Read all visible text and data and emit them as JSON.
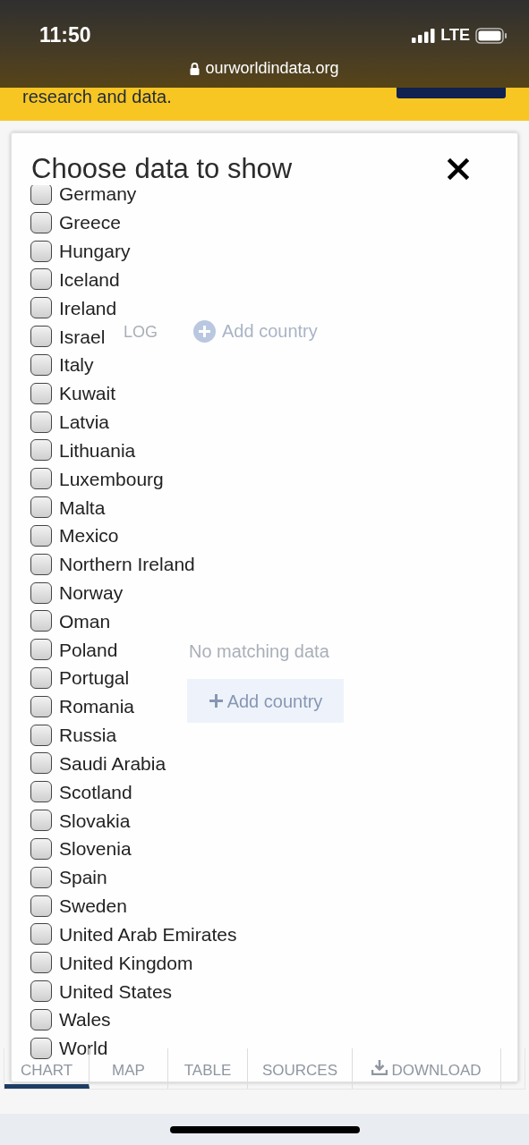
{
  "status_bar": {
    "time": "11:50",
    "network": "LTE"
  },
  "address_bar": {
    "url": "ourworldindata.org"
  },
  "banner": {
    "text": "research and data."
  },
  "background": {
    "toggle_label": "LOG",
    "add_country_link": "Add country",
    "empty_message": "No matching data",
    "add_country_button": "Add country",
    "tabs": [
      {
        "label": "CHART",
        "selected": true
      },
      {
        "label": "MAP",
        "selected": false
      },
      {
        "label": "TABLE",
        "selected": false
      },
      {
        "label": "SOURCES",
        "selected": false
      },
      {
        "label": "DOWNLOAD",
        "selected": false
      }
    ]
  },
  "dialog": {
    "title": "Choose data to show",
    "items": [
      {
        "label": "Germany",
        "checked": false
      },
      {
        "label": "Greece",
        "checked": false
      },
      {
        "label": "Hungary",
        "checked": false
      },
      {
        "label": "Iceland",
        "checked": false
      },
      {
        "label": "Ireland",
        "checked": false
      },
      {
        "label": "Israel",
        "checked": false
      },
      {
        "label": "Italy",
        "checked": false
      },
      {
        "label": "Kuwait",
        "checked": false
      },
      {
        "label": "Latvia",
        "checked": false
      },
      {
        "label": "Lithuania",
        "checked": false
      },
      {
        "label": "Luxembourg",
        "checked": false
      },
      {
        "label": "Malta",
        "checked": false
      },
      {
        "label": "Mexico",
        "checked": false
      },
      {
        "label": "Northern Ireland",
        "checked": false
      },
      {
        "label": "Norway",
        "checked": false
      },
      {
        "label": "Oman",
        "checked": false
      },
      {
        "label": "Poland",
        "checked": false
      },
      {
        "label": "Portugal",
        "checked": false
      },
      {
        "label": "Romania",
        "checked": false
      },
      {
        "label": "Russia",
        "checked": false
      },
      {
        "label": "Saudi Arabia",
        "checked": false
      },
      {
        "label": "Scotland",
        "checked": false
      },
      {
        "label": "Slovakia",
        "checked": false
      },
      {
        "label": "Slovenia",
        "checked": false
      },
      {
        "label": "Spain",
        "checked": false
      },
      {
        "label": "Sweden",
        "checked": false
      },
      {
        "label": "United Arab Emirates",
        "checked": false
      },
      {
        "label": "United Kingdom",
        "checked": false
      },
      {
        "label": "United States",
        "checked": false
      },
      {
        "label": "Wales",
        "checked": false
      },
      {
        "label": "World",
        "checked": false
      }
    ]
  }
}
